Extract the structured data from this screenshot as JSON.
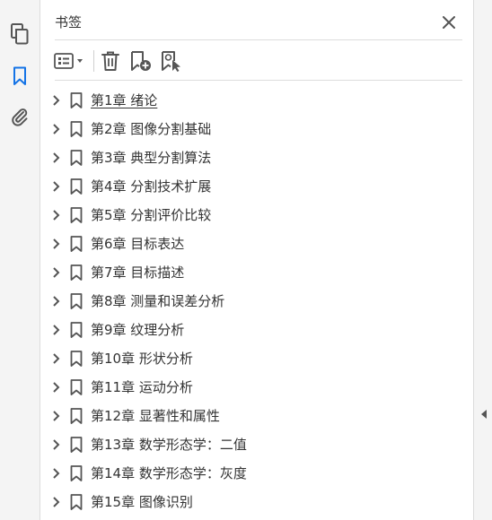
{
  "panel": {
    "title": "书签"
  },
  "icons": {
    "rail": [
      "pages-icon",
      "bookmark-icon",
      "attachment-icon"
    ],
    "toolbar": [
      "options-menu-icon",
      "delete-icon",
      "new-bookmark-icon",
      "bookmark-from-selection-icon"
    ],
    "close": "close-icon",
    "collapse": "collapse-panel-arrow-icon"
  },
  "colors": {
    "accent": "#1473e6",
    "icon": "#555555",
    "text": "#333333"
  },
  "bookmarks": [
    "第1章  绪论",
    "第2章  图像分割基础",
    "第3章  典型分割算法",
    "第4章  分割技术扩展",
    "第5章  分割评价比较",
    "第6章  目标表达",
    "第7章  目标描述",
    "第8章  测量和误差分析",
    "第9章  纹理分析",
    "第10章  形状分析",
    "第11章  运动分析",
    "第12章  显著性和属性",
    "第13章  数学形态学：二值",
    "第14章  数学形态学：灰度",
    "第15章  图像识别"
  ]
}
